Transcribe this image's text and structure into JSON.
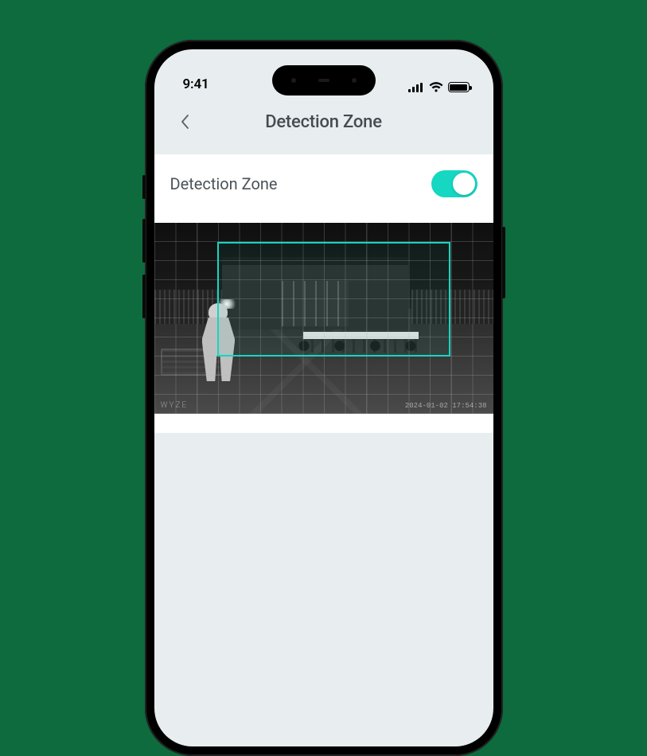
{
  "status_bar": {
    "time": "9:41"
  },
  "nav": {
    "title": "Detection Zone"
  },
  "settings": {
    "detection_zone": {
      "label": "Detection Zone",
      "enabled": true
    }
  },
  "camera_feed": {
    "watermark": "WYZE",
    "timestamp": "2024-01-02  17:54:38"
  },
  "colors": {
    "accent": "#16d7c1"
  }
}
